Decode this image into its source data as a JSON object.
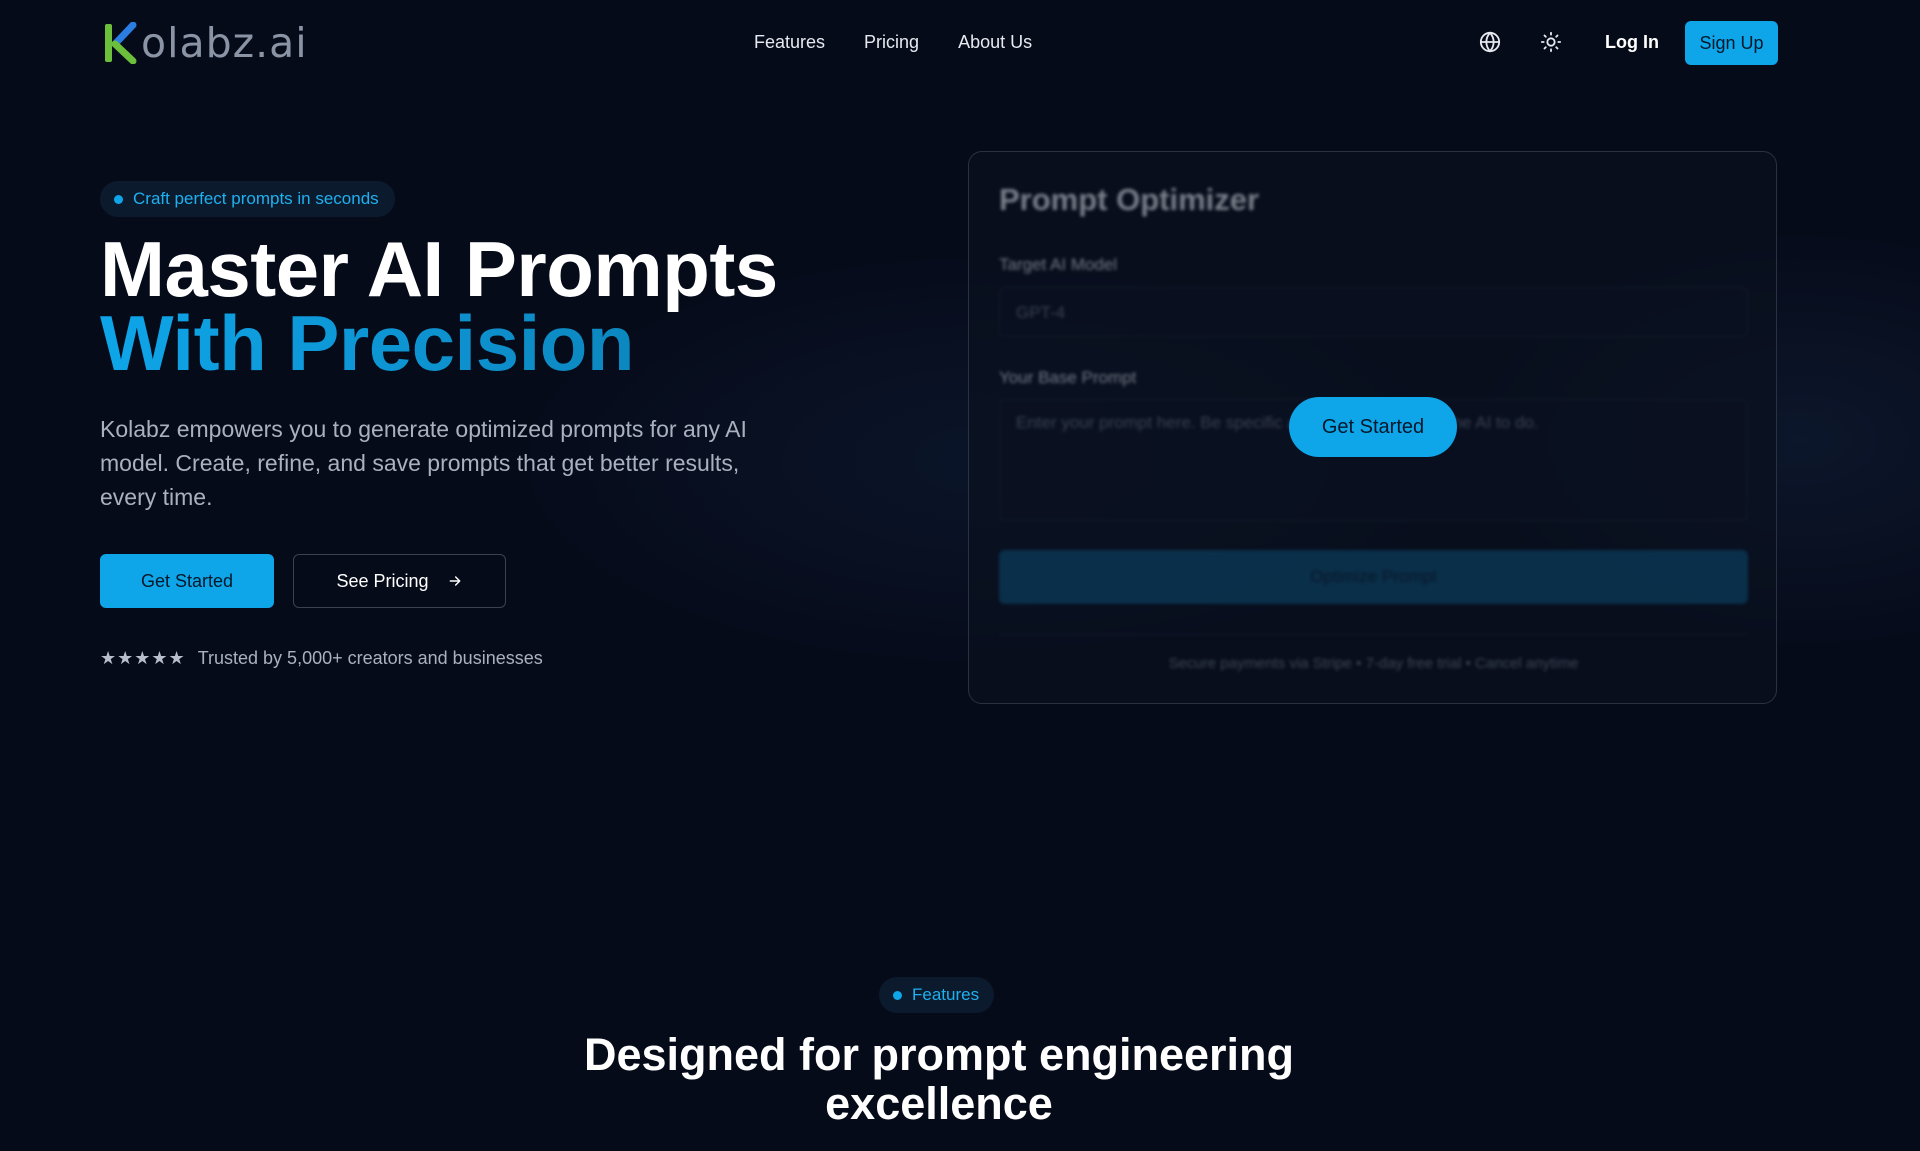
{
  "brand": {
    "name": "olabz.ai",
    "logo_letter": "K",
    "colors": {
      "k_green": "#6bbf3a",
      "k_blue": "#2a7de1"
    }
  },
  "nav": {
    "links": [
      "Features",
      "Pricing",
      "About Us"
    ],
    "globe_icon": "globe-icon",
    "theme_icon": "sun-icon",
    "login": "Log In",
    "signup": "Sign Up"
  },
  "hero": {
    "badge": "Craft perfect prompts in seconds",
    "title_line1": "Master AI Prompts",
    "title_line2": "With Precision",
    "description": "Kolabz empowers you to generate optimized prompts for any AI model. Create, refine, and save prompts that get better results, every time.",
    "primary_cta": "Get Started",
    "secondary_cta": "See Pricing",
    "stars": "★★★★★",
    "rating": 5,
    "trust": "Trusted by 5,000+ creators and businesses"
  },
  "card": {
    "title": "Prompt Optimizer",
    "model_label": "Target AI Model",
    "model_value": "GPT-4",
    "prompt_label": "Your Base Prompt",
    "prompt_placeholder": "Enter your prompt here. Be specific about what you want the AI to do.",
    "optimize_button": "Optimize Prompt",
    "footer": "Secure payments via Stripe • 7-day free trial • Cancel anytime",
    "overlay_cta": "Get Started"
  },
  "features": {
    "badge": "Features",
    "title_line1": "Designed for prompt engineering",
    "title_line2": "excellence"
  },
  "colors": {
    "accent": "#0ea5e9",
    "background": "#060b1a"
  }
}
